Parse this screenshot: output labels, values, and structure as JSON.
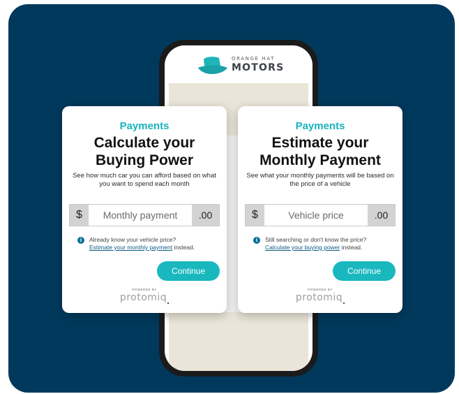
{
  "logo": {
    "line1": "ORANGE HAT",
    "line2": "MOTORS",
    "hat_color": "#1fb4b8"
  },
  "colors": {
    "background": "#00395c",
    "accent": "#19b8bf",
    "link": "#0d5c84"
  },
  "cards": [
    {
      "kicker": "Payments",
      "title": "Calculate your Buying Power",
      "description": "See how much car you can afford based on what you want to spend each month",
      "input": {
        "prefix": "$",
        "placeholder": "Monthly payment",
        "suffix": ".00"
      },
      "info_icon": "info-icon",
      "info_text": "Already know your vehicle price?",
      "info_link": "Estimate your monthly payment",
      "info_suffix": " instead.",
      "button": "Continue",
      "powered_by": "POWERED BY",
      "brand": "protomiq"
    },
    {
      "kicker": "Payments",
      "title": "Estimate your Monthly Payment",
      "description": "See what your monthly payments will be based on the price of a vehicle",
      "input": {
        "prefix": "$",
        "placeholder": "Vehicle price",
        "suffix": ".00"
      },
      "info_icon": "info-icon",
      "info_text": "Still searching or don't know the price?",
      "info_link": "Calculate your buying power",
      "info_suffix": " instead.",
      "button": "Continue",
      "powered_by": "POWERED BY",
      "brand": "protomiq"
    }
  ]
}
